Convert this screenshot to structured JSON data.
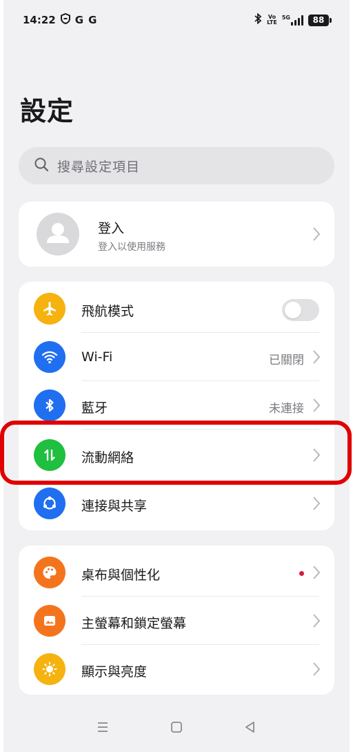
{
  "status_bar": {
    "time": "14:22",
    "left_icons": [
      "shield-icon",
      "G",
      "G"
    ],
    "right_icons": [
      "bluetooth-icon",
      "volte-icon",
      "5g-signal-icon"
    ],
    "volte_top": "Vo",
    "volte_bottom": "LTE",
    "network": "5G",
    "battery": "88"
  },
  "page": {
    "title": "設定"
  },
  "search": {
    "placeholder": "搜尋設定項目",
    "icon": "search-icon"
  },
  "account": {
    "title": "登入",
    "subtitle": "登入以使用服務",
    "icon": "avatar-person-icon"
  },
  "connect_group": {
    "items": [
      {
        "label": "飛航模式",
        "icon": "airplane-icon",
        "color": "#f6b20f",
        "control": "toggle",
        "toggle_on": false
      },
      {
        "label": "Wi-Fi",
        "icon": "wifi-icon",
        "color": "#1f6ff0",
        "value": "已關閉"
      },
      {
        "label": "藍牙",
        "icon": "bluetooth-icon",
        "color": "#1f6ff0",
        "value": "未連接"
      },
      {
        "label": "流動網絡",
        "icon": "mobile-data-icon",
        "color": "#1fbf3f",
        "value": ""
      },
      {
        "label": "連接與共享",
        "icon": "connection-share-icon",
        "color": "#1f6ff0",
        "value": ""
      }
    ]
  },
  "display_group": {
    "items": [
      {
        "label": "桌布與個性化",
        "icon": "palette-icon",
        "color": "#f4741e",
        "badge": "red-dot"
      },
      {
        "label": "主螢幕和鎖定螢幕",
        "icon": "home-lock-screen-icon",
        "color": "#f4741e"
      },
      {
        "label": "顯示與亮度",
        "icon": "brightness-icon",
        "color": "#f6b20f"
      }
    ]
  },
  "colors": {
    "highlight": "#e00000",
    "background": "#f1f1f3"
  },
  "nav_bar": {
    "icons": [
      "menu-icon",
      "home-icon",
      "back-icon"
    ]
  }
}
